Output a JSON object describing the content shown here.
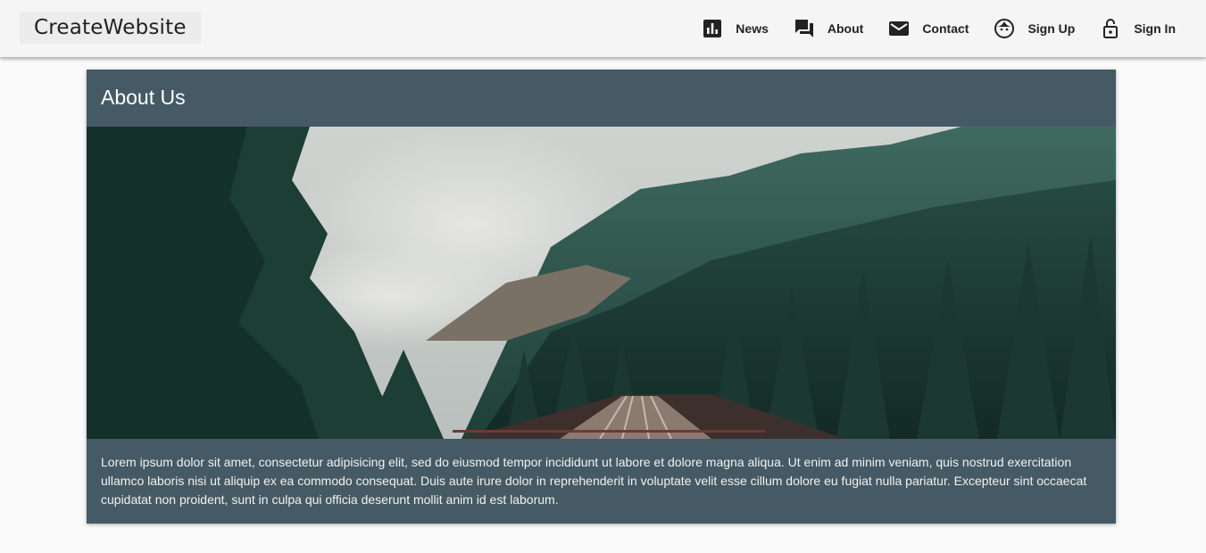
{
  "brand": {
    "label": "CreateWebsite"
  },
  "nav": {
    "items": [
      {
        "label": "News",
        "icon": "bar-chart-icon"
      },
      {
        "label": "About",
        "icon": "forum-icon"
      },
      {
        "label": "Contact",
        "icon": "mail-icon"
      },
      {
        "label": "Sign Up",
        "icon": "face-icon"
      },
      {
        "label": "Sign In",
        "icon": "lock-open-icon"
      }
    ]
  },
  "card": {
    "title": "About Us",
    "image_description_icon": "forest-railway-bridge-photo",
    "body": "Lorem ipsum dolor sit amet, consectetur adipisicing elit, sed do eiusmod tempor incididunt ut labore et dolore magna aliqua. Ut enim ad minim veniam, quis nostrud exercitation ullamco laboris nisi ut aliquip ex ea commodo consequat. Duis aute irure dolor in reprehenderit in voluptate velit esse cillum dolore eu fugiat nulla pariatur. Excepteur sint occaecat cupidatat non proident, sunt in culpa qui officia deserunt mollit anim id est laborum."
  },
  "colors": {
    "navbar_bg": "#f5f5f5",
    "page_bg": "#fafafa",
    "card_bg": "#455a64",
    "text_light": "#ffffff"
  }
}
